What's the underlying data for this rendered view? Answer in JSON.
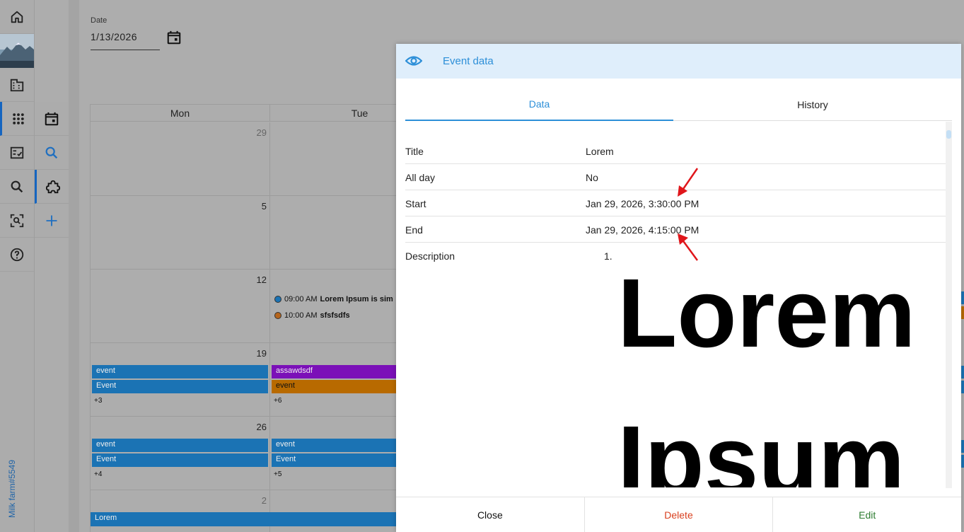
{
  "app": {
    "footer_label": "Milk farm#5549"
  },
  "date_field": {
    "label": "Date",
    "value": "1/13/2026"
  },
  "calendar": {
    "headers": [
      "Mon",
      "Tue"
    ],
    "weeks": [
      {
        "mon": "29",
        "tue": ""
      },
      {
        "mon": "5",
        "tue": ""
      },
      {
        "mon": "12",
        "tue": ""
      },
      {
        "mon": "19",
        "tue": ""
      },
      {
        "mon": "26",
        "tue": ""
      },
      {
        "mon": "2",
        "tue": ""
      }
    ],
    "tue_12_events": [
      {
        "time": "09:00 AM",
        "title": "Lorem Ipsum is sim",
        "color": "#1b73b4"
      },
      {
        "time": "10:00 AM",
        "title": "sfsfsdfs",
        "color": "#b5651d"
      }
    ],
    "mon_19_events": [
      "event",
      "Event"
    ],
    "mon_19_more": "+3",
    "tue_19_events": [
      "assawdsdf",
      "event"
    ],
    "tue_19_more": "+6",
    "mon_26_events": [
      "event",
      "Event"
    ],
    "mon_26_more": "+4",
    "tue_26_events": [
      "event",
      "Event"
    ],
    "tue_26_more": "+5",
    "week6_event": "Lorem"
  },
  "dialog": {
    "title": "Event data",
    "tabs": [
      "Data",
      "History"
    ],
    "rows": [
      {
        "key": "Title",
        "value": "Lorem"
      },
      {
        "key": "All day",
        "value": "No"
      },
      {
        "key": "Start",
        "value": "Jan 29, 2026, 3:30:00 PM"
      },
      {
        "key": "End",
        "value": "Jan 29, 2026, 4:15:00 PM"
      }
    ],
    "description_label": "Description",
    "description_list_num": "1.",
    "description_words": [
      "Lorem",
      "Ipsum"
    ],
    "buttons": {
      "close": "Close",
      "delete": "Delete",
      "edit": "Edit"
    }
  },
  "colors": {
    "accent": "#2d8fd8",
    "delete": "#d9401f",
    "edit": "#2e7d32",
    "event_blue": "#1b73b4",
    "event_purple": "#7b10b8",
    "event_orange": "#b86a00",
    "annotation_arrow": "#e0161b"
  }
}
